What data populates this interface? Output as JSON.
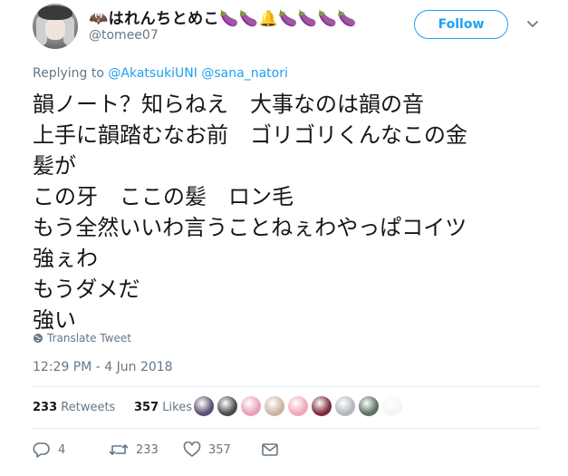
{
  "author": {
    "display_name": "🦇はれんちとめこ🍆🍆🔔🍆🍆🍆🍆",
    "handle": "@tomee07"
  },
  "follow_button": {
    "label": "Follow"
  },
  "reply": {
    "prefix": "Replying to",
    "mentions": [
      "@AkatsukiUNI",
      "@sana_natori"
    ]
  },
  "tweet": {
    "lines": [
      "韻ノート？知らねえ　大事なのは韻の音",
      "上手に韻踏むなお前　ゴリゴリくんなこの金",
      "髪が",
      "この牙　ここの髪　ロン毛",
      "もう全然いいわ言うことねぇわやっぱコイツ",
      "強ぇわ",
      "もうダメだ",
      "強い"
    ],
    "translate_label": "Translate Tweet",
    "timestamp": "12:29 PM - 4 Jun 2018"
  },
  "stats": {
    "retweets_count": "233",
    "retweets_label": "Retweets",
    "likes_count": "357",
    "likes_label": "Likes"
  },
  "likers": [
    "#5a5070",
    "#4a4a4a",
    "#e8a0b8",
    "#c9b4a0",
    "#f0a8b8",
    "#7a2a3a",
    "#b0b8c0",
    "#5a7060",
    "#f4f4f4"
  ],
  "actions": {
    "reply_count": "4",
    "retweet_count": "233",
    "like_count": "357"
  },
  "icons": {
    "more": "chevron-down-icon",
    "translate": "globe-icon",
    "reply": "reply-icon",
    "retweet": "retweet-icon",
    "like": "heart-icon",
    "message": "envelope-icon"
  },
  "colors": {
    "accent": "#1da1f2",
    "muted": "#657786",
    "text": "#14171a"
  }
}
